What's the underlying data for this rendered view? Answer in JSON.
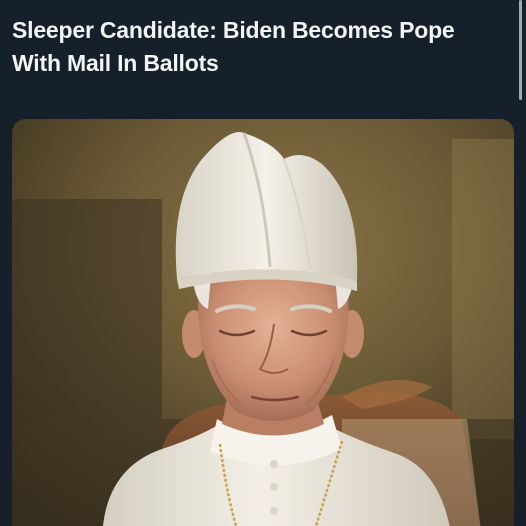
{
  "post": {
    "headline": "Sleeper Candidate: Biden Becomes Pope With Mail In Ballots"
  },
  "media": {
    "alt": "Elderly man in white papal mitre and cassock with eyes closed",
    "palette": {
      "background": "#15202b",
      "headline_text": "#f2f4f6",
      "mitre": "#ece8de",
      "robe": "#efeadf",
      "wall": "#6b5a36",
      "chair": "#7a4a2c"
    }
  }
}
